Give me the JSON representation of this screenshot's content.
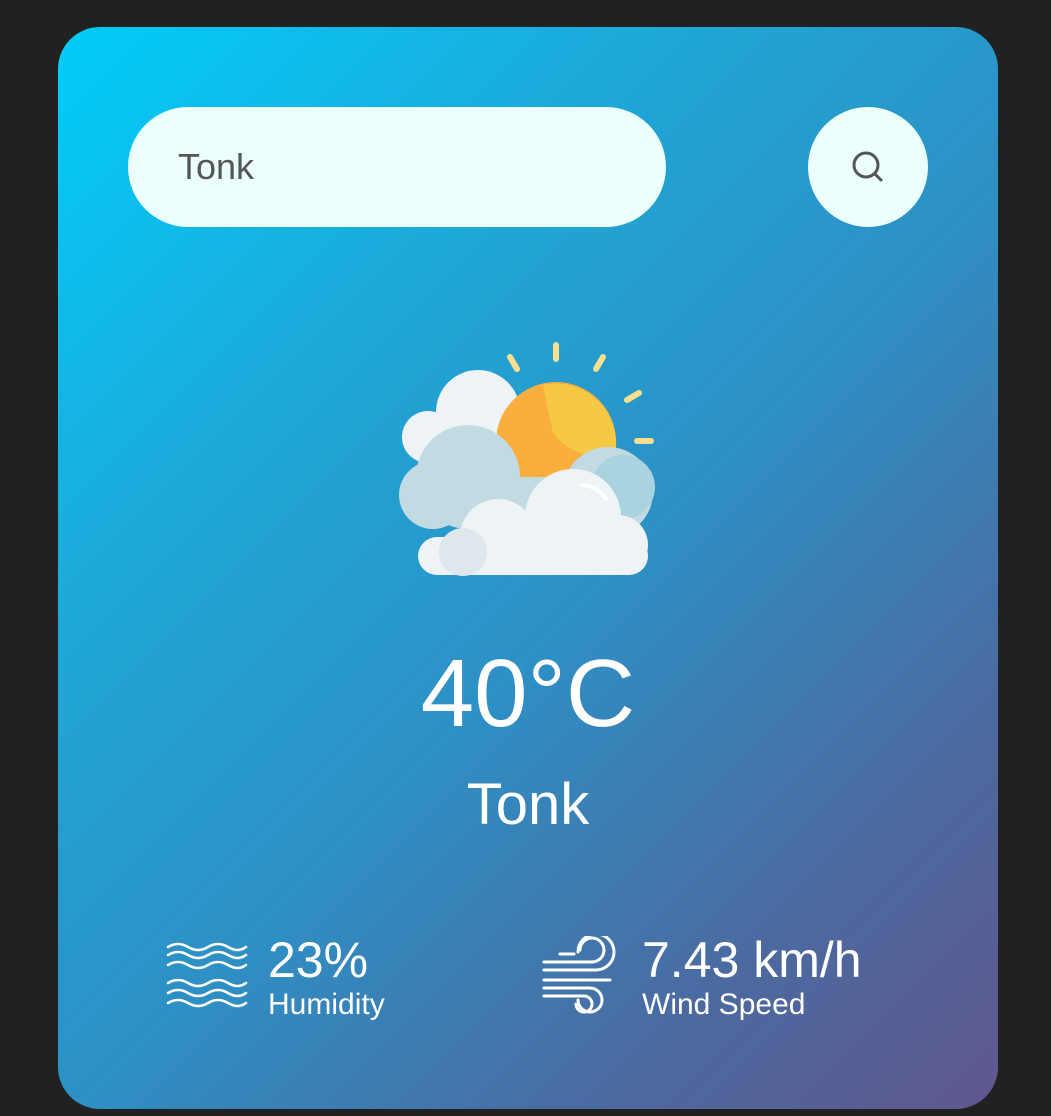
{
  "search": {
    "value": "Tonk",
    "button_icon": "search-icon"
  },
  "weather": {
    "icon": "partly-cloudy-sun-icon",
    "temperature": "40°C",
    "city": "Tonk"
  },
  "details": {
    "humidity": {
      "icon": "humidity-waves-icon",
      "value": "23%",
      "label": "Humidity"
    },
    "wind": {
      "icon": "wind-icon",
      "value": "7.43 km/h",
      "label": "Wind Speed"
    }
  },
  "colors": {
    "page_background": "#212121",
    "card_gradient_start": "#00cdfa",
    "card_gradient_end": "#60578e",
    "input_background": "#ebfffc",
    "text": "#ffffff"
  }
}
